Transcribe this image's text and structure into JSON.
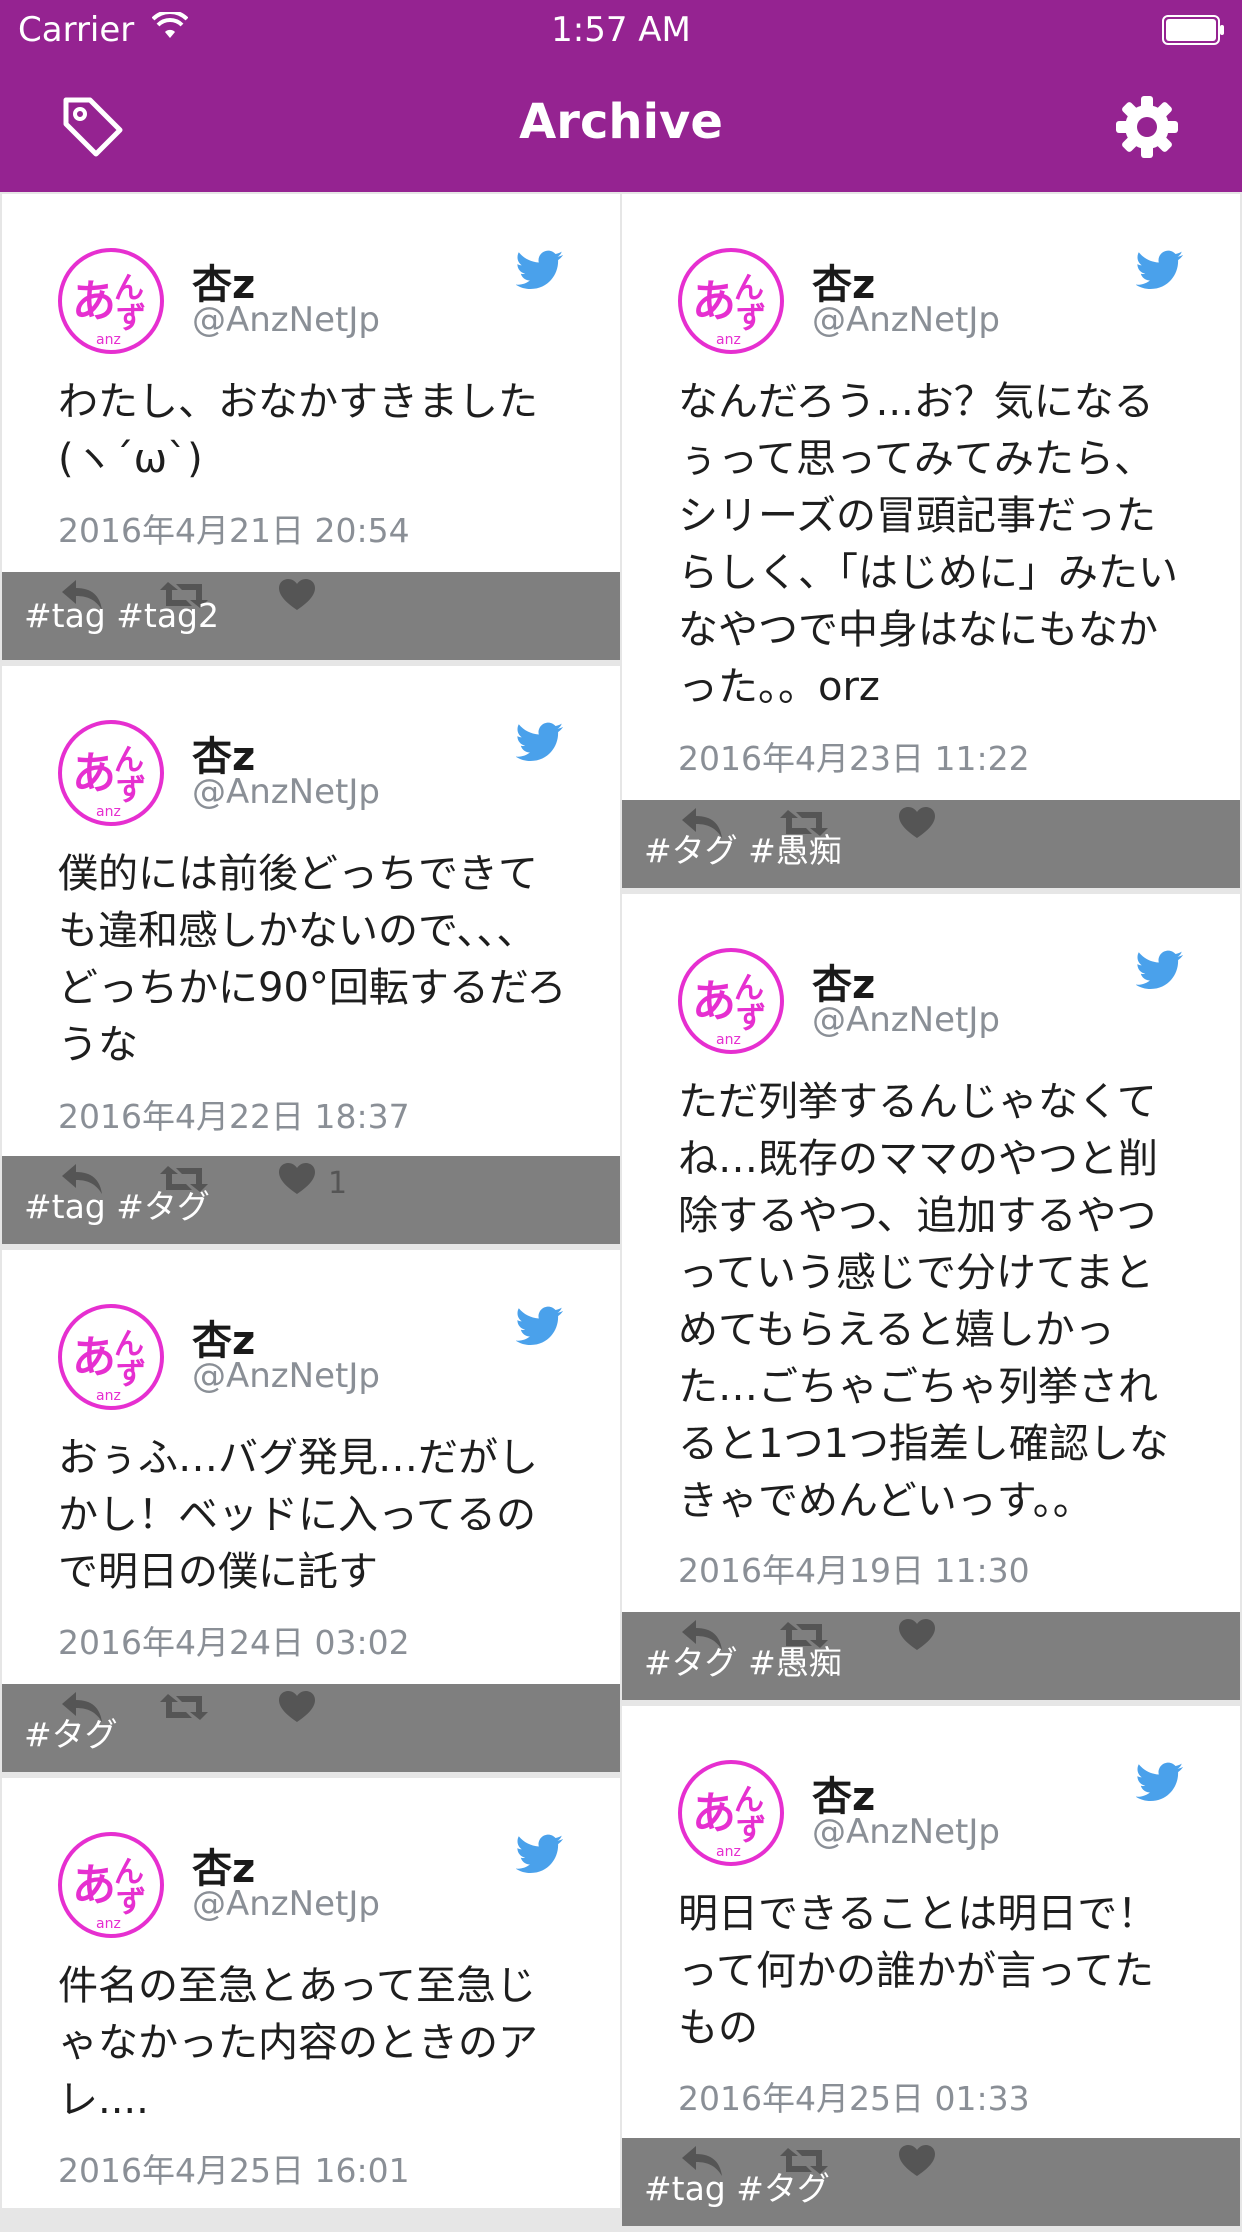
{
  "status_bar": {
    "carrier": "Carrier",
    "time": "1:57 AM"
  },
  "nav": {
    "title": "Archive",
    "left_icon": "tag-icon",
    "right_icon": "gear-icon"
  },
  "colors": {
    "brand": "#952391",
    "twitter": "#4aa1eb",
    "tag_bar": "#7f7f7f",
    "avatar_pink": "#e62fd0"
  },
  "left_column": [
    {
      "name": "杏z",
      "handle": "@AnzNetJp",
      "text": "わたし、おなかすきました(ヽ´ω`)",
      "date": "2016年4月21日 20:54",
      "tags": "#tag #tag2",
      "likes": ""
    },
    {
      "name": "杏z",
      "handle": "@AnzNetJp",
      "text": "僕的には前後どっちできても違和感しかないので、、、どっちかに90°回転するだろうな",
      "date": "2016年4月22日 18:37",
      "tags": "#tag #タグ",
      "likes": "1"
    },
    {
      "name": "杏z",
      "handle": "@AnzNetJp",
      "text": "おぅふ…バグ発見…だがしかし！ベッドに入ってるので明日の僕に託す",
      "date": "2016年4月24日 03:02",
      "tags": "#タグ",
      "likes": ""
    },
    {
      "name": "杏z",
      "handle": "@AnzNetJp",
      "text": "件名の至急とあって至急じゃなかった内容のときのアレ....",
      "date": "2016年4月25日 16:01",
      "tags": "",
      "likes": ""
    }
  ],
  "right_column": [
    {
      "name": "杏z",
      "handle": "@AnzNetJp",
      "text": "なんだろう...お？気になるぅって思ってみてみたら、シリーズの冒頭記事だったらしく、「はじめに」みたいなやつで中身はなにもなかった。。orz",
      "date": "2016年4月23日 11:22",
      "tags": "#タグ #愚痴",
      "likes": ""
    },
    {
      "name": "杏z",
      "handle": "@AnzNetJp",
      "text": "ただ列挙するんじゃなくてね…既存のママのやつと削除するやつ、追加するやつっていう感じで分けてまとめてもらえると嬉しかった…ごちゃごちゃ列挙されると1つ1つ指差し確認しなきゃでめんどいっす。。",
      "date": "2016年4月19日 11:30",
      "tags": "#タグ #愚痴",
      "likes": ""
    },
    {
      "name": "杏z",
      "handle": "@AnzNetJp",
      "text": "明日できることは明日で！って何かの誰かが言ってたもの",
      "date": "2016年4月25日 01:33",
      "tags": "#tag #タグ",
      "likes": ""
    }
  ]
}
